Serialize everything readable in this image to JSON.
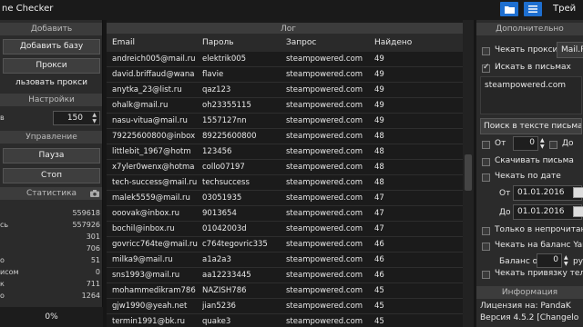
{
  "window": {
    "title": "ne Checker",
    "right_text": "Трей"
  },
  "left": {
    "add_section": "Добавить",
    "add_base_button": "Добавить базу",
    "proxy_button": "Прокси",
    "use_proxy_button": "льзовать прокси",
    "settings_section": "Настройки",
    "threads_label": "в",
    "threads_value": "150",
    "control_section": "Управление",
    "pause_button": "Пауза",
    "stop_button": "Стоп",
    "stats_section": "Статистика",
    "stats": [
      {
        "label": "",
        "value": "559618"
      },
      {
        "label": "сь",
        "value": "557926"
      },
      {
        "label": "",
        "value": "301"
      },
      {
        "label": "",
        "value": "706"
      },
      {
        "label": "о",
        "value": "51"
      },
      {
        "label": "исом",
        "value": "0"
      },
      {
        "label": "к",
        "value": "711"
      },
      {
        "label": "о",
        "value": "1264"
      }
    ],
    "progress": "0%"
  },
  "log": {
    "section": "Лог",
    "columns": [
      "Email",
      "Пароль",
      "Запрос",
      "Найдено"
    ],
    "rows": [
      [
        "andreich005@mail.ru",
        "elektrik005",
        "steampowered.com",
        "49"
      ],
      [
        "david.briffaud@wana",
        "flavie",
        "steampowered.com",
        "49"
      ],
      [
        "anytka_23@list.ru",
        "qaz123",
        "steampowered.com",
        "49"
      ],
      [
        "ohalk@mail.ru",
        "oh23355115",
        "steampowered.com",
        "49"
      ],
      [
        "nasu-vitua@mail.ru",
        "1557127nn",
        "steampowered.com",
        "49"
      ],
      [
        "79225600800@inbox",
        "89225600800",
        "steampowered.com",
        "48"
      ],
      [
        "littlebit_1967@hotm",
        "123456",
        "steampowered.com",
        "48"
      ],
      [
        "x7yler0wenx@hotma",
        "collo07197",
        "steampowered.com",
        "48"
      ],
      [
        "tech-success@mail.ru",
        "techsuccess",
        "steampowered.com",
        "48"
      ],
      [
        "malek5559@mail.ru",
        "03051935",
        "steampowered.com",
        "47"
      ],
      [
        "ooovak@inbox.ru",
        "9013654",
        "steampowered.com",
        "47"
      ],
      [
        "bochil@inbox.ru",
        "01042003d",
        "steampowered.com",
        "47"
      ],
      [
        "govricc764te@mail.ru",
        "c764tegovric335",
        "steampowered.com",
        "46"
      ],
      [
        "milka9@mail.ru",
        "a1a2a3",
        "steampowered.com",
        "46"
      ],
      [
        "sns1993@mail.ru",
        "aa12233445",
        "steampowered.com",
        "46"
      ],
      [
        "mohammedikram786",
        "NAZISH786",
        "steampowered.com",
        "45"
      ],
      [
        "gjw1990@yeah.net",
        "jian5236",
        "steampowered.com",
        "45"
      ],
      [
        "termin1991@bk.ru",
        "quake3",
        "steampowered.com",
        "45"
      ]
    ]
  },
  "right": {
    "section": "Дополнительно",
    "check_proxy_label": "Чекать прокси",
    "proxy_field": "Mail.R",
    "search_in_mail_label": "Искать в письмах",
    "search_query": "steampowered.com",
    "search_text_button": "Поиск в тексте письма",
    "from_label": "От",
    "from_value": "0",
    "to_label": "До",
    "download_label": "Скачивать письма",
    "check_date_label": "Чекать по дате",
    "date_from_label": "От",
    "date_from": "01.01.2016",
    "date_to_label": "До",
    "date_to": "01.01.2016",
    "unread_label": "Только в непрочитан",
    "balance_label": "Чекать на баланс Yanc",
    "balance_from_label": "Баланс от",
    "balance_value": "0",
    "balance_unit": "ру",
    "phone_label": "Чекать привязку телеф",
    "info_section": "Информация",
    "license": "Лицензия на: PandaK",
    "version": "Версия 4.5.2 [Changelo"
  }
}
